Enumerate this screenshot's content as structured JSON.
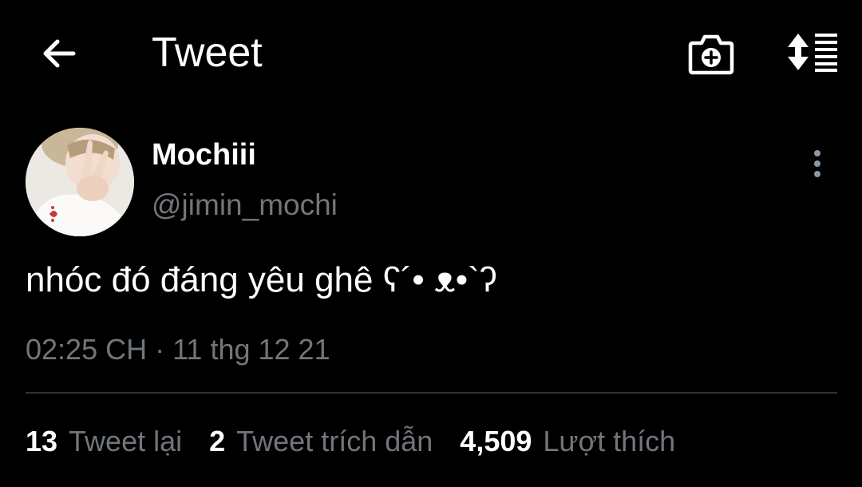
{
  "header": {
    "title": "Tweet",
    "back_icon": "back-arrow-icon",
    "camera_icon": "camera-plus-icon",
    "sort_icon": "sort-list-icon"
  },
  "tweet": {
    "display_name": "Mochiii",
    "handle": "@jimin_mochi",
    "text": "nhóc đó đáng yêu ghê ʕ´• ᴥ•`ʔ",
    "timestamp": "02:25 CH · 11 thg 12 21",
    "more_icon": "more-vertical-icon"
  },
  "stats": [
    {
      "count": "13",
      "label": "Tweet lại"
    },
    {
      "count": "2",
      "label": "Tweet trích dẫn"
    },
    {
      "count": "4,509",
      "label": "Lượt thích"
    }
  ],
  "colors": {
    "background": "#000000",
    "primary_text": "#ffffff",
    "secondary_text": "#71767b",
    "divider": "#2f3336"
  }
}
